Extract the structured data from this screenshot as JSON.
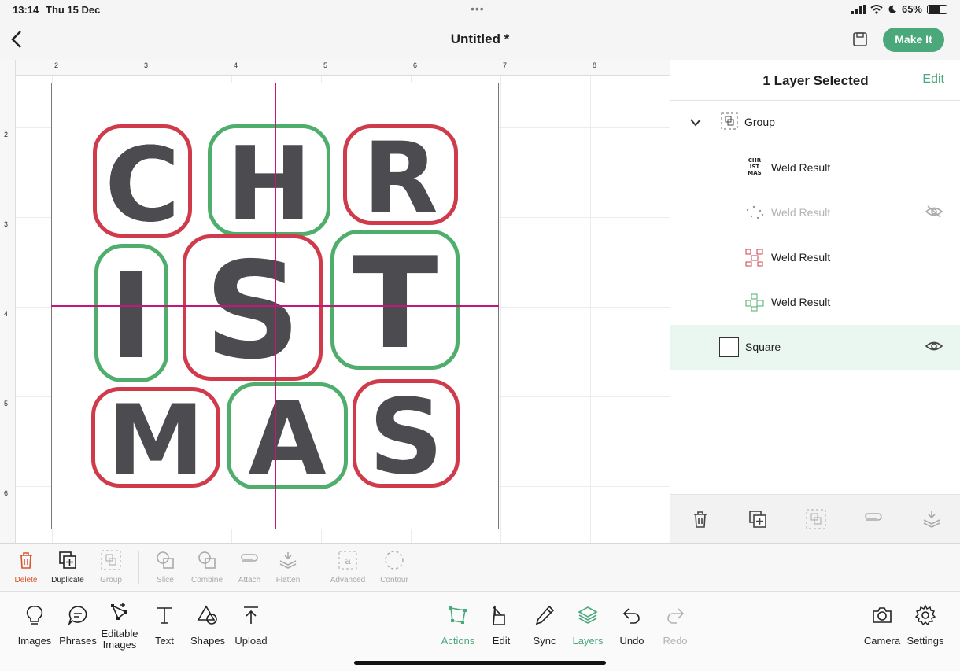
{
  "status": {
    "time": "13:14",
    "date": "Thu 15 Dec",
    "battery": "65%"
  },
  "header": {
    "title": "Untitled *",
    "make_it": "Make It"
  },
  "canvas": {
    "ruler_top": [
      "2",
      "3",
      "4",
      "5",
      "6",
      "7",
      "8"
    ],
    "ruler_left": [
      "2",
      "3",
      "4",
      "5",
      "6"
    ],
    "letters": [
      "C",
      "H",
      "R",
      "I",
      "S",
      "T",
      "M",
      "A",
      "S"
    ]
  },
  "layers": {
    "header": "1 Layer Selected",
    "edit": "Edit",
    "group": "Group",
    "items": [
      {
        "label": "Weld Result"
      },
      {
        "label": "Weld Result"
      },
      {
        "label": "Weld Result"
      },
      {
        "label": "Weld Result"
      }
    ],
    "square": "Square",
    "thumb_text": [
      "CHR",
      "IST",
      "MAS"
    ]
  },
  "edit_toolbar": {
    "delete": "Delete",
    "duplicate": "Duplicate",
    "group": "Group",
    "slice": "Slice",
    "combine": "Combine",
    "attach": "Attach",
    "flatten": "Flatten",
    "advanced": "Advanced",
    "contour": "Contour"
  },
  "bottom_bar": {
    "images": "Images",
    "phrases": "Phrases",
    "editable_images_1": "Editable",
    "editable_images_2": "Images",
    "text": "Text",
    "shapes": "Shapes",
    "upload": "Upload",
    "actions": "Actions",
    "edit": "Edit",
    "sync": "Sync",
    "layers": "Layers",
    "undo": "Undo",
    "redo": "Redo",
    "camera": "Camera",
    "settings": "Settings"
  },
  "colors": {
    "accent": "#4aa87a",
    "letter_fill": "#4c4b50",
    "red_outline": "#cf3b4a",
    "green_outline": "#4fae6c",
    "guide": "#c2187a"
  }
}
